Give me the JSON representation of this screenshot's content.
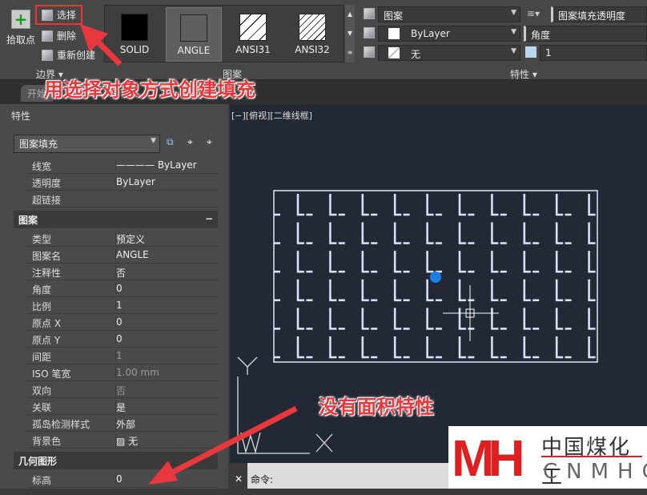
{
  "ribbon": {
    "pick_points": "拾取点",
    "select": "选择",
    "remove": "删除",
    "recreate": "重新创建",
    "boundary_panel": "边界 ▾",
    "pattern_panel": "图案",
    "properties_panel": "特性 ▾",
    "patterns": [
      {
        "name": "SOLID"
      },
      {
        "name": "ANGLE",
        "selected": true
      },
      {
        "name": "ANSI31"
      },
      {
        "name": "ANSI32"
      }
    ],
    "hatch_type": "图案",
    "color": "ByLayer",
    "background": "无",
    "transparency_label": "图案填充透明度",
    "angle_label": "角度",
    "scale": "1"
  },
  "tab": "开始",
  "properties": {
    "title": "特性",
    "selector": "图案填充",
    "general": [
      {
        "k": "线宽",
        "v": "———— ByLayer"
      },
      {
        "k": "透明度",
        "v": "ByLayer"
      },
      {
        "k": "超链接",
        "v": ""
      }
    ],
    "pattern_section": "图案",
    "pattern": [
      {
        "k": "类型",
        "v": "预定义"
      },
      {
        "k": "图案名",
        "v": "ANGLE"
      },
      {
        "k": "注释性",
        "v": "否"
      },
      {
        "k": "角度",
        "v": "0"
      },
      {
        "k": "比例",
        "v": "1"
      },
      {
        "k": "原点 X",
        "v": "0"
      },
      {
        "k": "原点 Y",
        "v": "0"
      },
      {
        "k": "间距",
        "v": "1",
        "dim": true
      },
      {
        "k": "ISO 笔宽",
        "v": "1.00 mm",
        "dim": true
      },
      {
        "k": "双向",
        "v": "否",
        "dim": true
      },
      {
        "k": "关联",
        "v": "是"
      },
      {
        "k": "孤岛检测样式",
        "v": "外部"
      },
      {
        "k": "背景色",
        "v": "▨ 无"
      }
    ],
    "geometry_section": "几何图形",
    "geometry": [
      {
        "k": "标高",
        "v": "0"
      }
    ]
  },
  "viewport": {
    "label": "[−][俯视][二维线框]"
  },
  "command": {
    "prompt": "命令:",
    "close": "✕"
  },
  "annotations": {
    "top": "用选择对象方式创建填充",
    "bottom": "没有面积特性"
  },
  "logo": {
    "cn": "中国煤化工",
    "en": "CNMHG"
  },
  "colors": {
    "accent": "#e8383d",
    "canvas": "#222834",
    "hatch": "#dfe6ff"
  }
}
